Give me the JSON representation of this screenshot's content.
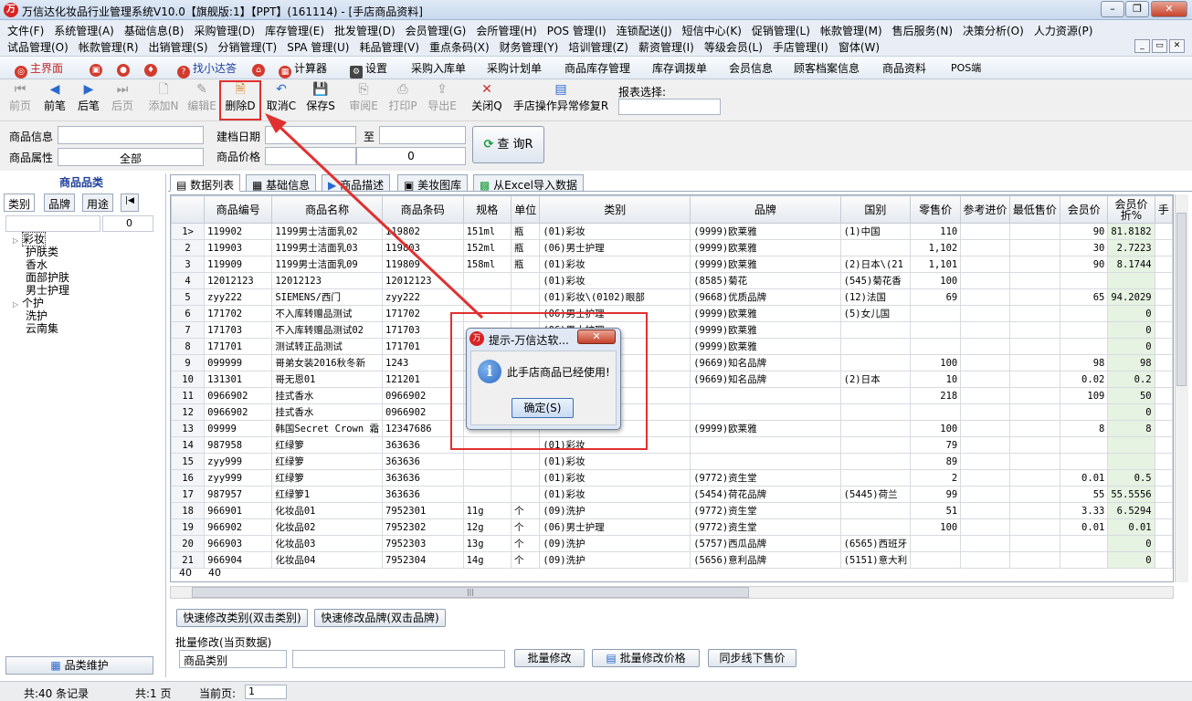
{
  "window": {
    "title": "万信达化妆品行业管理系统V10.0【旗舰版:1】【PPT】(161114) - [手店商品资料]",
    "app_icon": "app-logo-icon"
  },
  "menus": {
    "row1": [
      "文件(F)",
      "系统管理(A)",
      "基础信息(B)",
      "采购管理(D)",
      "库存管理(E)",
      "批发管理(D)",
      "会员管理(G)",
      "会所管理(H)",
      "POS 管理(I)",
      "连锁配送(J)",
      "短信中心(K)",
      "促销管理(L)",
      "帐款管理(M)",
      "售后服务(N)",
      "决策分析(O)",
      "人力资源(P)"
    ],
    "row2": [
      "试品管理(O)",
      "帐款管理(R)",
      "出销管理(S)",
      "分销管理(T)",
      "SPA 管理(U)",
      "耗品管理(V)",
      "重点条码(X)",
      "财务管理(Y)",
      "培训管理(Z)",
      "薪资管理(I)",
      "等级会员(L)",
      "手店管理(I)",
      "窗体(W)"
    ]
  },
  "quickbar": [
    "主界面",
    "",
    "",
    "",
    "找小达答",
    "",
    "计算器",
    "设置",
    "采购入库单",
    "采购计划单",
    "商品库存管理",
    "库存调拨单",
    "会员信息",
    "顾客档案信息",
    "商品资料",
    "POS端"
  ],
  "toolbar": {
    "first": "前页",
    "prev": "前笔",
    "next": "后笔",
    "last": "后页",
    "add": "添加N",
    "edit": "编辑E",
    "delete": "删除D",
    "cancel": "取消C",
    "save": "保存S",
    "audit": "审阅E",
    "print": "打印P",
    "export": "导出E",
    "close": "关闭Q",
    "repair": "手店操作异常修复R",
    "report_label": "报表选择:"
  },
  "filter": {
    "product_info_label": "商品信息",
    "product_attr_label": "商品属性",
    "product_attr_value": "全部",
    "created_label": "建档日期",
    "to_label": "至",
    "price_label": "商品价格",
    "price_value": "0",
    "query_button": "查  询R"
  },
  "left_panel": {
    "title": "商品品类",
    "tabs": [
      "类别",
      "品牌",
      "用途",
      "|◀"
    ],
    "count": "0",
    "tree": [
      "彩妆",
      "护肤类",
      "香水",
      "面部护肤",
      "男士护理",
      "个护",
      "洗护",
      "云南集"
    ],
    "maintain_button": "品类维护"
  },
  "tabs": [
    "数据列表",
    "基础信息",
    "商品描述",
    "美妆图库",
    "从Excel导入数据"
  ],
  "grid": {
    "headers": [
      "",
      "商品编号",
      "商品名称",
      "商品条码",
      "规格",
      "单位",
      "类别",
      "品牌",
      "国别",
      "零售价",
      "参考进价",
      "最低售价",
      "会员价",
      "会员价折%",
      "手"
    ],
    "rows": [
      [
        "1>",
        "119902",
        "1199男士洁面乳02",
        "119802",
        "151ml",
        "瓶",
        "(01)彩妆",
        "(9999)欧莱雅",
        "(1)中国",
        "110",
        "",
        "",
        "90",
        "81.8182"
      ],
      [
        "2",
        "119903",
        "1199男士洁面乳03",
        "119803",
        "152ml",
        "瓶",
        "(06)男士护理",
        "(9999)欧莱雅",
        "",
        "1,102",
        "",
        "",
        "30",
        "2.7223"
      ],
      [
        "3",
        "119909",
        "1199男士洁面乳09",
        "119809",
        "158ml",
        "瓶",
        "(01)彩妆",
        "(9999)欧莱雅",
        "(2)日本\\(21",
        "1,101",
        "",
        "",
        "90",
        "8.1744"
      ],
      [
        "4",
        "12012123",
        "12012123",
        "12012123",
        "",
        "",
        "(01)彩妆",
        "(8585)菊花",
        "(545)菊花香",
        "100",
        "",
        "",
        "",
        ""
      ],
      [
        "5",
        "zyy222",
        "SIEMENS/西门",
        "zyy222",
        "",
        "",
        "(01)彩妆\\(0102)眼部",
        "(9668)优质品牌",
        "(12)法国",
        "69",
        "",
        "",
        "65",
        "94.2029"
      ],
      [
        "6",
        "171702",
        "不入库转赠品测试",
        "171702",
        "",
        "",
        "(06)男士护理",
        "(9999)欧莱雅",
        "(5)女儿国",
        "",
        "",
        "",
        "",
        "0"
      ],
      [
        "7",
        "171703",
        "不入库转赠品测试02",
        "171703",
        "",
        "",
        "(06)男士护理",
        "(9999)欧莱雅",
        "",
        "",
        "",
        "",
        "",
        "0"
      ],
      [
        "8",
        "171701",
        "测试转正品测试",
        "171701",
        "",
        "",
        "",
        "(9999)欧莱雅",
        "",
        "",
        "",
        "",
        "",
        "0"
      ],
      [
        "9",
        "099999",
        "哥弟女装2016秋冬新",
        "1243",
        "",
        "",
        "",
        "(9669)知名品牌",
        "",
        "100",
        "",
        "",
        "98",
        "98"
      ],
      [
        "10",
        "131301",
        "哥无恩01",
        "121201",
        "1",
        "",
        "",
        "(9669)知名品牌",
        "(2)日本",
        "10",
        "",
        "",
        "0.02",
        "0.2"
      ],
      [
        "11",
        "0966902",
        "挂式香水",
        "0966902",
        "",
        "",
        "",
        "",
        "",
        "218",
        "",
        "",
        "109",
        "50"
      ],
      [
        "12",
        "0966902",
        "挂式香水",
        "0966902",
        "",
        "",
        "",
        "",
        "",
        "",
        "",
        "",
        "",
        "0"
      ],
      [
        "13",
        "09999",
        "韩国Secret Crown 霜",
        "12347686",
        "",
        "",
        "",
        "(9999)欧莱雅",
        "",
        "100",
        "",
        "",
        "8",
        "8"
      ],
      [
        "14",
        "987958",
        "红绿箩",
        "363636",
        "",
        "",
        "(01)彩妆",
        "",
        "",
        "79",
        "",
        "",
        "",
        ""
      ],
      [
        "15",
        "zyy999",
        "红绿箩",
        "363636",
        "",
        "",
        "(01)彩妆",
        "",
        "",
        "89",
        "",
        "",
        "",
        ""
      ],
      [
        "16",
        "zyy999",
        "红绿箩",
        "363636",
        "",
        "",
        "(01)彩妆",
        "(9772)资生堂",
        "",
        "2",
        "",
        "",
        "0.01",
        "0.5"
      ],
      [
        "17",
        "987957",
        "红绿箩1",
        "363636",
        "",
        "",
        "(01)彩妆",
        "(5454)荷花品牌",
        "(5445)荷兰",
        "99",
        "",
        "",
        "55",
        "55.5556"
      ],
      [
        "18",
        "966901",
        "化妆品01",
        "7952301",
        "11g",
        "个",
        "(09)洗护",
        "(9772)资生堂",
        "",
        "51",
        "",
        "",
        "3.33",
        "6.5294"
      ],
      [
        "19",
        "966902",
        "化妆品02",
        "7952302",
        "12g",
        "个",
        "(06)男士护理",
        "(9772)资生堂",
        "",
        "100",
        "",
        "",
        "0.01",
        "0.01"
      ],
      [
        "20",
        "966903",
        "化妆品03",
        "7952303",
        "13g",
        "个",
        "(09)洗护",
        "(5757)西瓜品牌",
        "(6565)西班牙",
        "",
        "",
        "",
        "",
        "0"
      ],
      [
        "21",
        "966904",
        "化妆品04",
        "7952304",
        "14g",
        "个",
        "(09)洗护",
        "(5656)意利品牌",
        "(5151)意大利",
        "",
        "",
        "",
        "",
        "0"
      ]
    ],
    "footer_left": "40",
    "footer_count": "40"
  },
  "bottom": {
    "quick_category": "快速修改类别(双击类别)",
    "quick_brand": "快速修改品牌(双击品牌)",
    "batch_label": "批量修改(当页数据)",
    "batch_field": "商品类别",
    "batch_modify": "批量修改",
    "batch_price": "批量修改价格",
    "sync_offline": "同步线下售价"
  },
  "status": {
    "records": "共:40 条记录",
    "pages": "共:1 页",
    "current_label": "当前页:",
    "current_page": "1"
  },
  "dialog": {
    "title": "提示-万信达软...",
    "message": "此手店商品已经使用!",
    "ok_button": "确定(S)"
  },
  "colors": {
    "annotation": "#e03030",
    "accent": "#1f3f9a",
    "green_cell": "#e6f2e2"
  }
}
